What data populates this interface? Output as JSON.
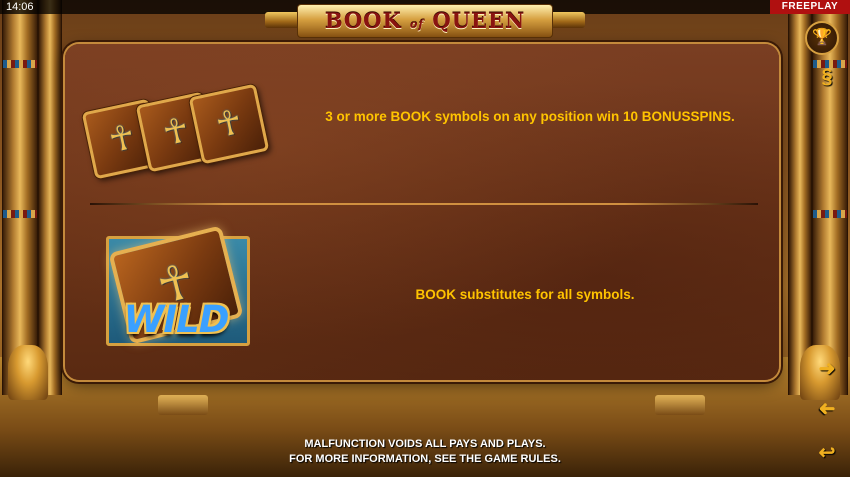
{
  "status_bar": {
    "time": "14:06",
    "mode": "FREEPLAY"
  },
  "logo": {
    "part1": "BOOK",
    "part2": "of",
    "part3": "QUEEN"
  },
  "rules": [
    {
      "symbol": "book-stack",
      "text": "3 or more BOOK symbols on any position win 10 BONUSSPINS."
    },
    {
      "symbol": "wild-book",
      "symbol_label": "WILD",
      "text": "BOOK substitutes for all symbols."
    }
  ],
  "footer": {
    "line1": "MALFUNCTION VOIDS ALL PAYS AND PLAYS.",
    "line2": "FOR MORE INFORMATION, SEE THE GAME RULES."
  },
  "side_controls": {
    "trophy_icon": "trophy-icon",
    "paragraph_icon": "paragraph-icon",
    "next_icon": "arrow-right-icon",
    "prev_icon": "arrow-left-icon",
    "back_icon": "return-icon"
  },
  "colors": {
    "accent": "#ffc400",
    "freeplay": "#b01010",
    "panel": "#6a3318"
  }
}
